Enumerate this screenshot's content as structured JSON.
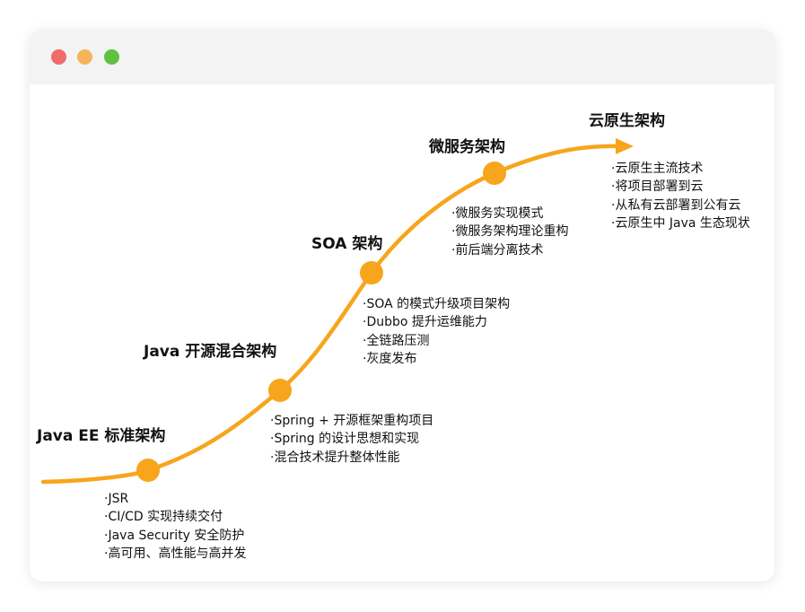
{
  "window": {
    "controls": {
      "close_color": "#f06b6b",
      "minimize_color": "#f7b35a",
      "zoom_color": "#5fc041"
    }
  },
  "accent_color": "#f7a51c",
  "stages": [
    {
      "title": "Java EE 标准架构",
      "points": [
        "JSR",
        "CI/CD 实现持续交付",
        "Java Security 安全防护",
        "高可用、高性能与高并发"
      ]
    },
    {
      "title": "Java 开源混合架构",
      "points": [
        "Spring + 开源框架重构项目",
        "Spring 的设计思想和实现",
        "混合技术提升整体性能"
      ]
    },
    {
      "title": "SOA 架构",
      "points": [
        "SOA 的模式升级项目架构",
        "Dubbo 提升运维能力",
        "全链路压测",
        "灰度发布"
      ]
    },
    {
      "title": "微服务架构",
      "points": [
        "微服务实现模式",
        "微服务架构理论重构",
        "前后端分离技术"
      ]
    },
    {
      "title": "云原生架构",
      "points": [
        "云原生主流技术",
        "将项目部署到云",
        "从私有云部署到公有云",
        "云原生中 Java 生态现状"
      ]
    }
  ]
}
